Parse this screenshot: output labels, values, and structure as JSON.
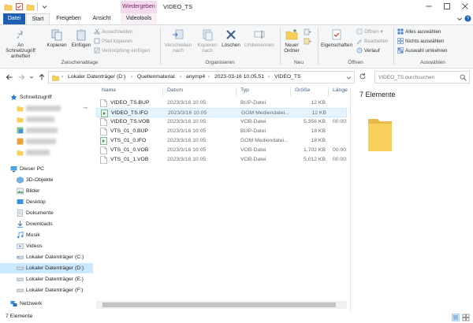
{
  "window": {
    "title": "VIDEO_TS",
    "context_tab": "Wiedergeben"
  },
  "ribbon_tabs": [
    "Datei",
    "Start",
    "Freigeben",
    "Ansicht",
    "Videotools"
  ],
  "ribbon": {
    "zwischenablage": {
      "label": "Zwischenablage",
      "pin_label_1": "An Schnellzugriff",
      "pin_label_2": "anheften",
      "copy_label": "Kopieren",
      "paste_label": "Einfügen",
      "cut_label": "Ausschneiden",
      "copy_path_label": "Pfad kopieren",
      "paste_shortcut_label": "Verknüpfung einfügen"
    },
    "organisieren": {
      "label": "Organisieren",
      "move_label_1": "Verschieben",
      "move_label_2": "nach",
      "copyto_label_1": "Kopieren",
      "copyto_label_2": "nach",
      "delete_label": "Löschen",
      "rename_label": "Umbenennen"
    },
    "neu": {
      "label": "Neu",
      "new_folder_label_1": "Neuer",
      "new_folder_label_2": "Ordner"
    },
    "oeffnen": {
      "label": "Öffnen",
      "properties_label": "Eigenschaften",
      "open_label": "Öffnen",
      "edit_label": "Bearbeiten",
      "history_label": "Verlauf"
    },
    "auswaehlen": {
      "label": "Auswählen",
      "select_all_label": "Alles auswählen",
      "select_none_label": "Nichts auswählen",
      "invert_label": "Auswahl umkehren"
    }
  },
  "address": {
    "crumbs": [
      "Lokaler Datenträger (D:)",
      "Quellenmaterial",
      "anymp4",
      "2023-03-16 10.05.51",
      "VIDEO_TS"
    ],
    "search_placeholder": "VIDEO_TS durchsuchen"
  },
  "nav": {
    "quick_access": "Schnellzugriff",
    "this_pc": "Dieser PC",
    "items": [
      "3D-Objekte",
      "Bilder",
      "Desktop",
      "Dokumente",
      "Downloads",
      "Musik",
      "Videos",
      "Lokaler Datenträger (C:)",
      "Lokaler Datenträger (D:)",
      "Lokaler Datenträger (E:)",
      "Lokaler Datenträger (F:)"
    ],
    "network": "Netzwerk"
  },
  "file_list": {
    "columns": [
      "Name",
      "Datum",
      "Typ",
      "Größe",
      "Länge"
    ],
    "rows": [
      {
        "name": "VIDEO_TS.BUP",
        "date": "2023/3/16 10:05",
        "type": "BUP-Datei",
        "size": "12 KB",
        "length": "",
        "icon": "file-icon"
      },
      {
        "name": "VIDEO_TS.IFO",
        "date": "2023/3/16 10:05",
        "type": "GOM Mediendatei...",
        "size": "12 KB",
        "length": "",
        "icon": "media-icon"
      },
      {
        "name": "VIDEO_TS.VOB",
        "date": "2023/3/16 10:05",
        "type": "VOB-Datei",
        "size": "5,356 KB",
        "length": "00:00:",
        "icon": "file-icon"
      },
      {
        "name": "VTS_01_0.BUP",
        "date": "2023/3/16 10:05",
        "type": "BUP-Datei",
        "size": "18 KB",
        "length": "",
        "icon": "file-icon"
      },
      {
        "name": "VTS_01_0.IFO",
        "date": "2023/3/16 10:05",
        "type": "GOM Mediendatei...",
        "size": "18 KB",
        "length": "",
        "icon": "media-icon"
      },
      {
        "name": "VTS_01_0.VOB",
        "date": "2023/3/16 10:05",
        "type": "VOB-Datei",
        "size": "1,702 KB",
        "length": "00:00:",
        "icon": "file-icon"
      },
      {
        "name": "VTS_01_1.VOB",
        "date": "2023/3/16 10:05",
        "type": "VOB-Datei",
        "size": "5,012 KB",
        "length": "00:00:",
        "icon": "file-icon"
      }
    ]
  },
  "preview": {
    "count_text": "7 Elemente"
  },
  "status": {
    "count_text": "7 Elemente"
  },
  "colors": {
    "accent": "#1f5fb1",
    "selection": "#cce8ff",
    "folder": "#f8cf5b",
    "context_tab": "#f5d9ef"
  }
}
